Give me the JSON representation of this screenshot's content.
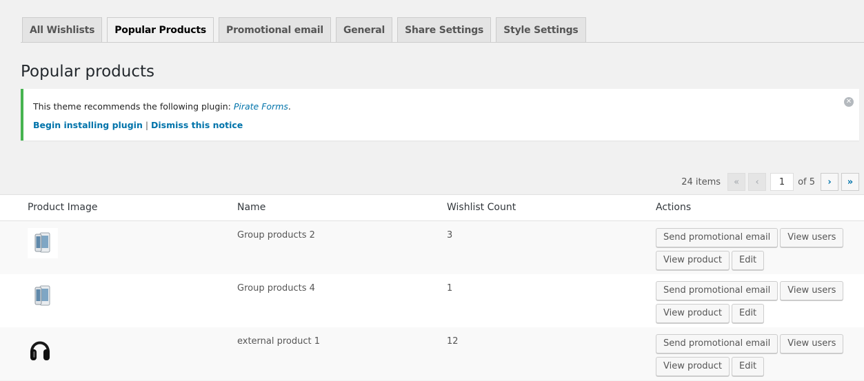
{
  "tabs": [
    {
      "label": "All Wishlists",
      "active": false
    },
    {
      "label": "Popular Products",
      "active": true
    },
    {
      "label": "Promotional email",
      "active": false
    },
    {
      "label": "General",
      "active": false
    },
    {
      "label": "Share Settings",
      "active": false
    },
    {
      "label": "Style Settings",
      "active": false
    }
  ],
  "page_title": "Popular products",
  "notice": {
    "text_prefix": "This theme recommends the following plugin: ",
    "plugin_name": "Pirate Forms",
    "text_suffix": ".",
    "begin_link": "Begin installing plugin",
    "separator": " | ",
    "dismiss_link": "Dismiss this notice",
    "close_icon": "dismiss-icon",
    "accent_color": "#46b450"
  },
  "pagination": {
    "items_label": "24 items",
    "first": "«",
    "prev": "‹",
    "current_page": "1",
    "of_label": "of 5",
    "next": "›",
    "last": "»"
  },
  "table": {
    "columns": [
      "Product Image",
      "Name",
      "Wishlist Count",
      "Actions"
    ],
    "rows": [
      {
        "image": "phone-image",
        "name": "Group products 2",
        "count": "3"
      },
      {
        "image": "phone-image",
        "name": "Group products 4",
        "count": "1"
      },
      {
        "image": "headphones-image",
        "name": "external product 1",
        "count": "12"
      }
    ],
    "actions": {
      "send_email": "Send promotional email",
      "view_users": "View users",
      "view_product": "View product",
      "edit": "Edit"
    }
  },
  "colors": {
    "link": "#0073aa",
    "background": "#f1f1f1"
  }
}
